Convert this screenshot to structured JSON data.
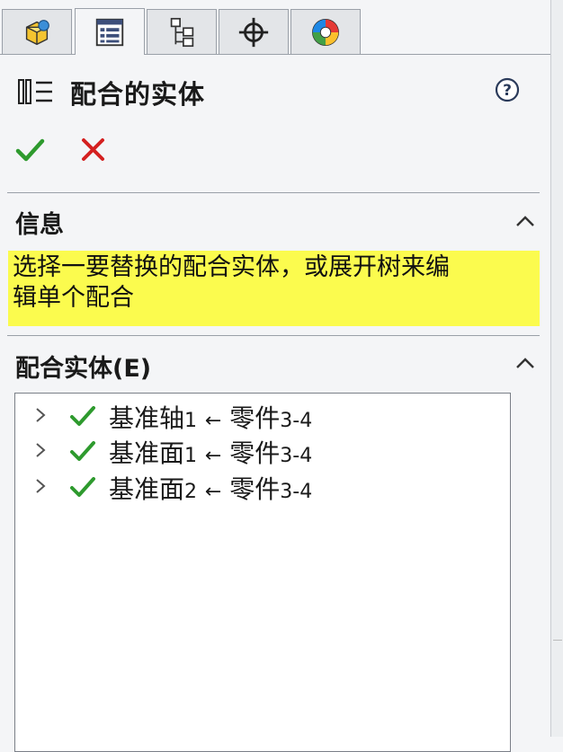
{
  "tabs": [
    {
      "icon": "feature-manager-icon"
    },
    {
      "icon": "property-manager-icon"
    },
    {
      "icon": "configuration-manager-icon"
    },
    {
      "icon": "dimxpert-icon"
    },
    {
      "icon": "display-manager-icon"
    }
  ],
  "header": {
    "title": "配合的实体",
    "icon": "mate-entities-icon",
    "help_icon": "help-icon"
  },
  "actions": {
    "ok_icon": "checkmark-icon",
    "cancel_icon": "close-icon"
  },
  "info": {
    "heading": "信息",
    "message_line1": "选择一要替换的配合实体，或展开树来编",
    "message_line2": "辑单个配合"
  },
  "mate_entities": {
    "heading": "配合实体(E)",
    "items": [
      {
        "name": "基准轴",
        "num": "1",
        "arrow": "←",
        "target": "零件",
        "target_num": "3-4"
      },
      {
        "name": "基准面",
        "num": "1",
        "arrow": "←",
        "target": "零件",
        "target_num": "3-4"
      },
      {
        "name": "基准面",
        "num": "2",
        "arrow": "←",
        "target": "零件",
        "target_num": "3-4"
      }
    ]
  },
  "colors": {
    "highlight": "#fbfb4e",
    "ok_green": "#2e9a2e",
    "cancel_red": "#d42020"
  }
}
